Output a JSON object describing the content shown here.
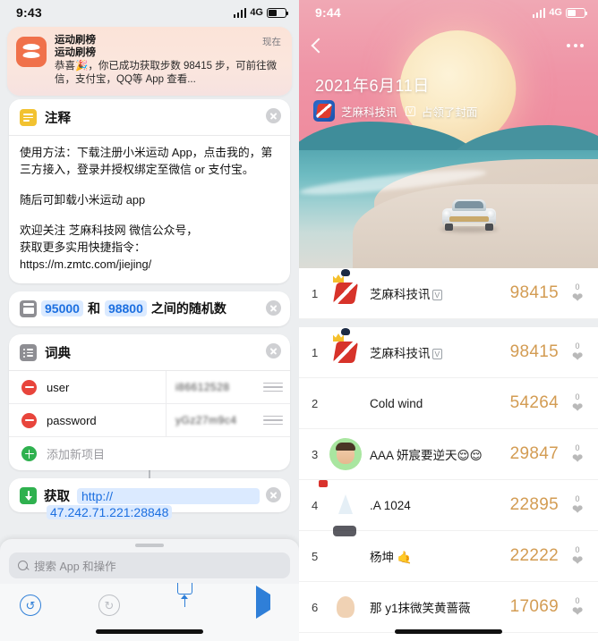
{
  "left": {
    "status": {
      "time": "9:43",
      "network": "4G"
    },
    "notification": {
      "app": "运动刷榜",
      "title": "运动刷榜",
      "body": "恭喜🎉，你已成功获取步数 98415 步，可前往微信，支付宝，QQ等 App 查看...",
      "time": "现在"
    },
    "cards": {
      "comment": {
        "icon": "note-icon",
        "title": "注释",
        "paragraph1": "使用方法：下载注册小米运动 App，点击我的，第三方接入，登录并授权绑定至微信 or 支付宝。",
        "paragraph2": "随后可卸载小米运动 app",
        "paragraph3": "欢迎关注 芝麻科技网 微信公众号，",
        "paragraph4": "获取更多实用快捷指令：",
        "paragraph5": "https://m.zmtc.com/jiejing/"
      },
      "random": {
        "icon": "calculator-icon",
        "min": "95000",
        "join": "和",
        "max": "98800",
        "suffix": "之间的随机数"
      },
      "dictionary": {
        "icon": "list-icon",
        "title": "词典",
        "rows": [
          {
            "key": "user",
            "value": "i86612528"
          },
          {
            "key": "password",
            "value": "yGz27m9c4"
          }
        ],
        "add_label": "添加新项目"
      },
      "geturl": {
        "icon": "download-icon",
        "label": "获取",
        "url": "http://",
        "url_overflow": "47.242.71.221:28848"
      }
    },
    "search": {
      "placeholder": "搜索 App 和操作"
    },
    "toolbar": {
      "undo": "↺",
      "redo": "↻",
      "share": "share-icon",
      "play": "play-icon"
    }
  },
  "right": {
    "status": {
      "time": "9:44",
      "network": "4G"
    },
    "hero": {
      "back": "back-icon",
      "more": "more-icon",
      "date": "2021年6月11日",
      "owner": "芝麻科技讯",
      "verified": "V",
      "subtitle": "占领了封面"
    },
    "ranking": [
      {
        "rank": "1",
        "name": "芝麻科技讯",
        "verified": "V",
        "score": "98415",
        "likes": "0",
        "avatar": "brand-avatar",
        "crown": true,
        "pinned": true
      },
      {
        "rank": "1",
        "name": "芝麻科技讯",
        "verified": "V",
        "score": "98415",
        "likes": "0",
        "avatar": "brand-avatar",
        "crown": true,
        "pinned": false
      },
      {
        "rank": "2",
        "name": "Cold wind",
        "verified": "",
        "score": "54264",
        "likes": "0",
        "avatar": "photo-avatar-2",
        "crown": false,
        "pinned": false
      },
      {
        "rank": "3",
        "name": "AAA   妍宸要逆天😌😌",
        "verified": "",
        "score": "29847",
        "likes": "0",
        "avatar": "photo-avatar-3",
        "crown": false,
        "pinned": false
      },
      {
        "rank": "4",
        "name": ".A 1024",
        "verified": "",
        "score": "22895",
        "likes": "0",
        "avatar": "photo-avatar-4",
        "crown": false,
        "pinned": false
      },
      {
        "rank": "5",
        "name": "杨坤 🤙",
        "verified": "",
        "score": "22222",
        "likes": "0",
        "avatar": "photo-avatar-5",
        "crown": false,
        "pinned": false
      },
      {
        "rank": "6",
        "name": "那 y1抹微笑黄蔷薇",
        "verified": "",
        "score": "17069",
        "likes": "0",
        "avatar": "photo-avatar-6",
        "crown": false,
        "pinned": false
      }
    ]
  },
  "colors": {
    "accent_blue": "#1c6fe0",
    "score_gold": "#d39c53",
    "notif_bg": "#fbe3d8",
    "app_icon": "#f0714a",
    "green": "#2fb14f",
    "red": "#e8453c"
  }
}
